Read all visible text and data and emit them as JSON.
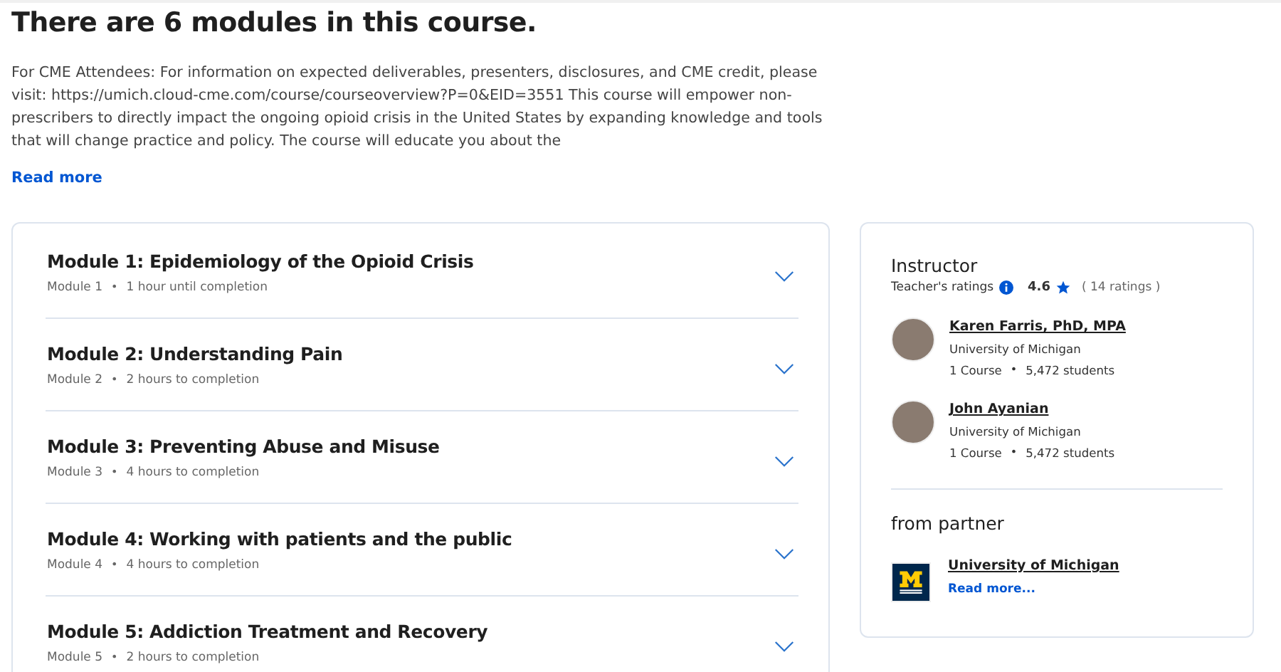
{
  "heading": "There are 6 modules in this course.",
  "description": "For CME Attendees: For information on expected deliverables, presenters, disclosures, and CME credit, please visit: https://umich.cloud-cme.com/course/courseoverview?P=0&EID=3551 This course will empower non-prescribers to directly impact the ongoing opioid crisis in the United States by expanding knowledge and tools that will change practice and policy. The course will educate you about the",
  "read_more": "Read more",
  "modules": [
    {
      "title": "Module 1: Epidemiology of the Opioid Crisis",
      "label": "Module 1",
      "separator": "•",
      "duration": "1 hour until completion",
      "expanded": false
    },
    {
      "title": "Module 2: Understanding Pain",
      "label": "Module 2",
      "separator": "•",
      "duration": "2 hours to completion",
      "expanded": false
    },
    {
      "title": "Module 3: Preventing Abuse and Misuse",
      "label": "Module 3",
      "separator": "•",
      "duration": "4 hours to completion",
      "expanded": false
    },
    {
      "title": "Module 4: Working with patients and the public",
      "label": "Module 4",
      "separator": "•",
      "duration": "4 hours to completion",
      "expanded": false
    },
    {
      "title": "Module 5: Addiction Treatment and Recovery",
      "label": "Module 5",
      "separator": "•",
      "duration": "2 hours to completion",
      "expanded": false
    }
  ],
  "instructor": {
    "title": "Instructor",
    "ratings_label": "Teacher's ratings",
    "rating": "4.6",
    "ratings_count": "( 14 ratings )",
    "people": [
      {
        "name": "Karen Farris, PhD, MPA",
        "org": "University of Michigan",
        "courses": "1 Course",
        "separator": "•",
        "students": "5,472 students"
      },
      {
        "name": "John Ayanian",
        "org": "University of Michigan",
        "courses": "1 Course",
        "separator": "•",
        "students": "5,472 students"
      }
    ]
  },
  "partner": {
    "title": "from partner",
    "name": "University of Michigan",
    "read_more": "Read more..."
  }
}
